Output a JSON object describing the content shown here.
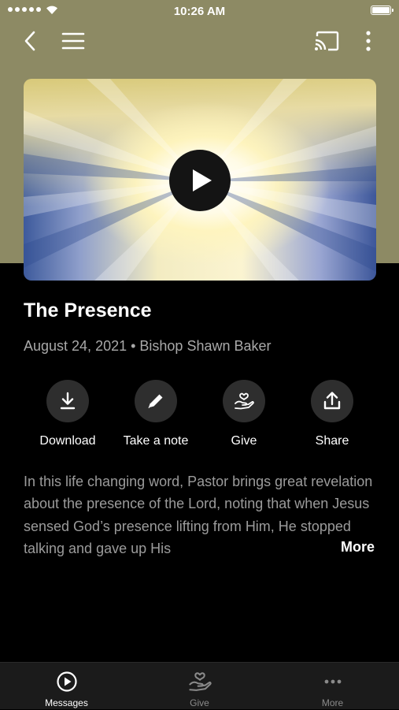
{
  "status_bar": {
    "time": "10:26 AM"
  },
  "toolbar": {
    "back_icon": "chevron-left-icon",
    "menu_icon": "hamburger-menu-icon",
    "cast_icon": "cast-icon",
    "more_icon": "more-vertical-icon"
  },
  "media": {
    "play_icon": "play-icon"
  },
  "sermon": {
    "title": "The Presence",
    "meta": "August 24, 2021 • Bishop Shawn Baker",
    "description": "In this life changing word, Pastor brings great revelation about the presence of the Lord, noting that when Jesus sensed God’s presence lifting from Him, He stopped talking and gave up His",
    "more_label": "More"
  },
  "actions": [
    {
      "label": "Download",
      "icon": "download-icon"
    },
    {
      "label": "Take a note",
      "icon": "pencil-icon"
    },
    {
      "label": "Give",
      "icon": "heart-hand-icon"
    },
    {
      "label": "Share",
      "icon": "share-icon"
    }
  ],
  "tabbar": {
    "tabs": [
      {
        "label": "Messages",
        "icon": "play-circle-icon",
        "active": true
      },
      {
        "label": "Give",
        "icon": "heart-hand-icon",
        "active": false
      },
      {
        "label": "More",
        "icon": "more-horizontal-icon",
        "active": false
      }
    ]
  },
  "colors": {
    "header_background": "#8d8a64",
    "page_background": "#000000",
    "tab_bar_background": "#1b1b1b",
    "action_button_background": "#2e2e2e",
    "secondary_text": "#a9a9a9"
  }
}
